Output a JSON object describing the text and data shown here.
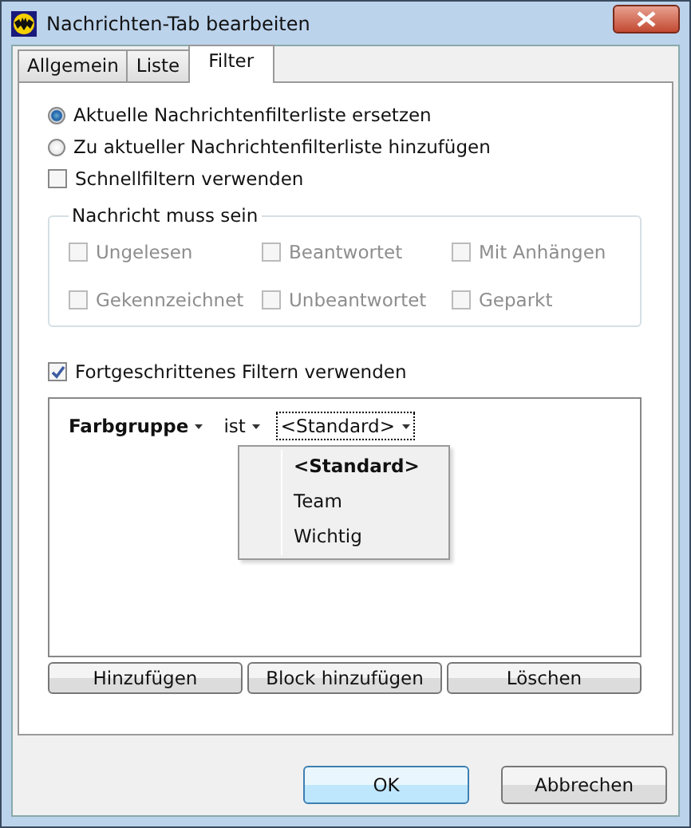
{
  "window": {
    "title": "Nachrichten-Tab bearbeiten"
  },
  "tabs": [
    {
      "label": "Allgemein",
      "selected": false
    },
    {
      "label": "Liste",
      "selected": false
    },
    {
      "label": "Filter",
      "selected": true
    }
  ],
  "mode_options": [
    {
      "label": "Aktuelle Nachrichtenfilterliste ersetzen",
      "selected": true
    },
    {
      "label": "Zu aktueller Nachrichtenfilterliste hinzufügen",
      "selected": false
    }
  ],
  "quick_filter": {
    "label": "Schnellfiltern verwenden",
    "checked": false
  },
  "message_group": {
    "title": "Nachricht muss sein",
    "disabled": true,
    "options": [
      {
        "label": "Ungelesen",
        "checked": false
      },
      {
        "label": "Beantwortet",
        "checked": false
      },
      {
        "label": "Mit Anhängen",
        "checked": false
      },
      {
        "label": "Gekennzeichnet",
        "checked": false
      },
      {
        "label": "Unbeantwortet",
        "checked": false
      },
      {
        "label": "Geparkt",
        "checked": false
      }
    ]
  },
  "advanced_filter": {
    "label": "Fortgeschrittenes Filtern verwenden",
    "checked": true
  },
  "filter_rule": {
    "field": "Farbgruppe",
    "operator": "ist",
    "value": "<Standard>"
  },
  "value_menu": {
    "items": [
      {
        "label": "<Standard>",
        "selected": true
      },
      {
        "label": "Team",
        "selected": false
      },
      {
        "label": "Wichtig",
        "selected": false
      }
    ]
  },
  "rule_buttons": [
    {
      "label": "Hinzufügen"
    },
    {
      "label": "Block hinzufügen"
    },
    {
      "label": "Löschen"
    }
  ],
  "dialog_buttons": [
    {
      "label": "OK",
      "default": true
    },
    {
      "label": "Abbrechen",
      "default": false
    }
  ]
}
